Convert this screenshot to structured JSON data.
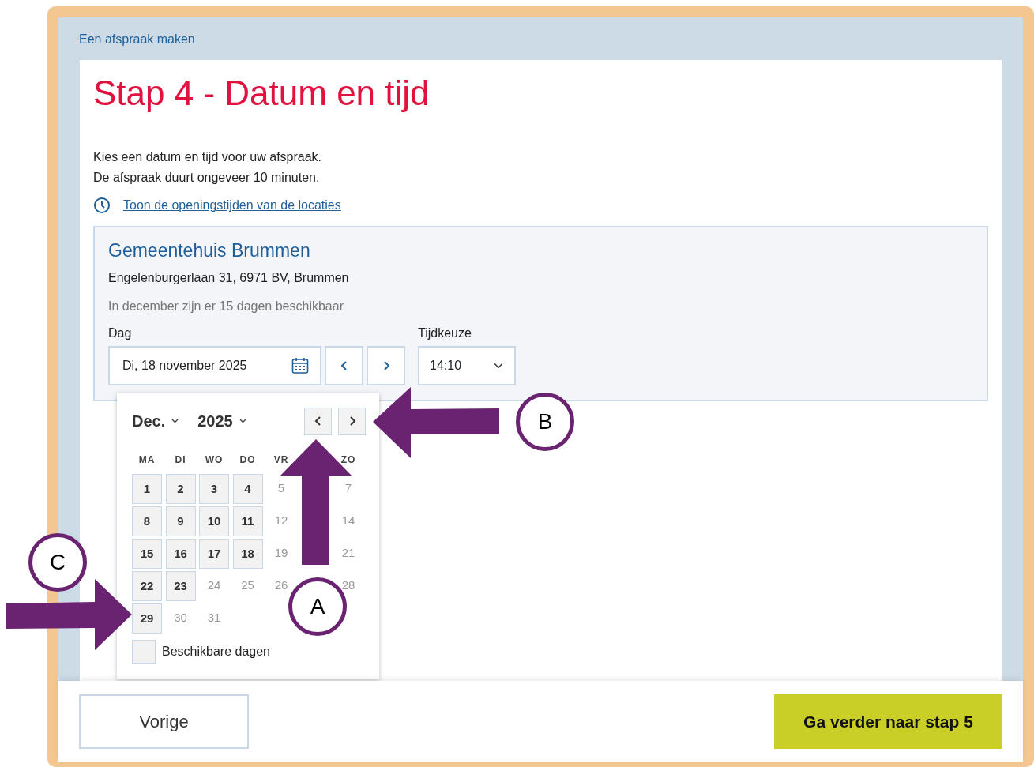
{
  "header": {
    "breadcrumb": "Een afspraak maken"
  },
  "title": "Stap 4 - Datum en tijd",
  "intro": [
    "Kies een datum en tijd voor uw afspraak.",
    "De afspraak duurt ongeveer 10 minuten."
  ],
  "hours_link": "Toon de openingstijden van de locaties",
  "location": {
    "name": "Gemeentehuis Brummen",
    "address": "Engelenburgerlaan 31, 6971 BV, Brummen",
    "availability": "In december zijn er 15 dagen beschikbaar",
    "day_label": "Dag",
    "day_value": "Di, 18 november 2025",
    "time_label": "Tijdkeuze",
    "time_value": "14:10"
  },
  "datepicker": {
    "month": "Dec.",
    "year": "2025",
    "weekdays": [
      {
        "kind": "label",
        "text": "MA"
      },
      {
        "kind": "label",
        "text": "DI"
      },
      {
        "kind": "label",
        "text": "WO"
      },
      {
        "kind": "label",
        "text": "DO"
      },
      {
        "kind": "label",
        "text": "VR"
      },
      {
        "kind": "covered"
      },
      {
        "kind": "label",
        "text": "ZO"
      }
    ],
    "weeks": [
      [
        {
          "kind": "day",
          "day": "1",
          "available": true
        },
        {
          "kind": "day",
          "day": "2",
          "available": true
        },
        {
          "kind": "day",
          "day": "3",
          "available": true
        },
        {
          "kind": "day",
          "day": "4",
          "available": true
        },
        {
          "kind": "day",
          "day": "5",
          "available": false
        },
        {
          "kind": "covered"
        },
        {
          "kind": "day",
          "day": "7",
          "available": false
        }
      ],
      [
        {
          "kind": "day",
          "day": "8",
          "available": true
        },
        {
          "kind": "day",
          "day": "9",
          "available": true
        },
        {
          "kind": "day",
          "day": "10",
          "available": true
        },
        {
          "kind": "day",
          "day": "11",
          "available": true
        },
        {
          "kind": "day",
          "day": "12",
          "available": false
        },
        {
          "kind": "covered"
        },
        {
          "kind": "day",
          "day": "14",
          "available": false
        }
      ],
      [
        {
          "kind": "day",
          "day": "15",
          "available": true
        },
        {
          "kind": "day",
          "day": "16",
          "available": true
        },
        {
          "kind": "day",
          "day": "17",
          "available": true
        },
        {
          "kind": "day",
          "day": "18",
          "available": true
        },
        {
          "kind": "day",
          "day": "19",
          "available": false
        },
        {
          "kind": "covered"
        },
        {
          "kind": "day",
          "day": "21",
          "available": false
        }
      ],
      [
        {
          "kind": "day",
          "day": "22",
          "available": true
        },
        {
          "kind": "day",
          "day": "23",
          "available": true
        },
        {
          "kind": "day",
          "day": "24",
          "available": false
        },
        {
          "kind": "day",
          "day": "25",
          "available": false
        },
        {
          "kind": "day",
          "day": "26",
          "available": false
        },
        {
          "kind": "covered"
        },
        {
          "kind": "day",
          "day": "28",
          "available": false
        }
      ],
      [
        {
          "kind": "day",
          "day": "29",
          "available": true
        },
        {
          "kind": "day",
          "day": "30",
          "available": false
        },
        {
          "kind": "day",
          "day": "31",
          "available": false
        }
      ]
    ],
    "legend": "Beschikbare dagen"
  },
  "footer": {
    "back": "Vorige",
    "next": "Ga verder naar stap 5"
  },
  "annotations": [
    {
      "label": "A",
      "kind": "up"
    },
    {
      "label": "B",
      "kind": "left"
    },
    {
      "label": "C",
      "kind": "right"
    }
  ]
}
